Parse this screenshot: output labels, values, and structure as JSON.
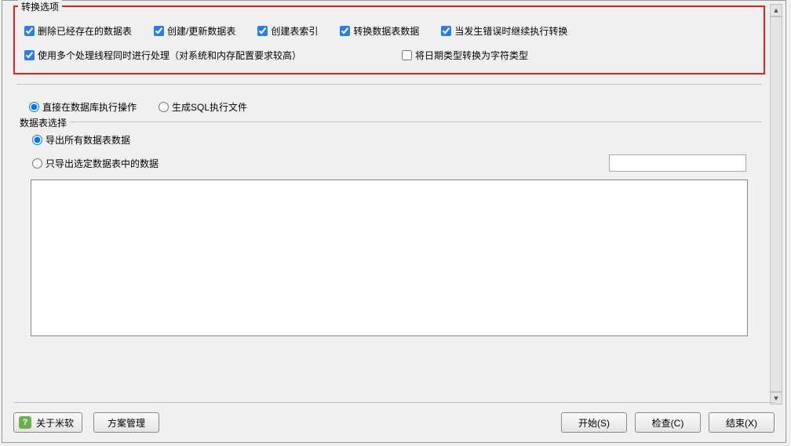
{
  "conversionOptions": {
    "legend": "转换选项",
    "row1": {
      "deleteExisting": {
        "label": "删除已经存在的数据表",
        "checked": true
      },
      "createUpdate": {
        "label": "创建/更新数据表",
        "checked": true
      },
      "createIndex": {
        "label": "创建表索引",
        "checked": true
      },
      "convertData": {
        "label": "转换数据表数据",
        "checked": true
      },
      "continueOnError": {
        "label": "当发生错误时继续执行转换",
        "checked": true
      }
    },
    "row2": {
      "multiThread": {
        "label": "使用多个处理线程同时进行处理（对系统和内存配置要求较高）",
        "checked": true
      },
      "dateToString": {
        "label": "将日期类型转换为字符类型",
        "checked": false
      }
    }
  },
  "executionMode": {
    "direct": {
      "label": "直接在数据库执行操作",
      "selected": true
    },
    "generateSql": {
      "label": "生成SQL执行文件",
      "selected": false
    }
  },
  "tableSelection": {
    "legend": "数据表选择",
    "exportAll": {
      "label": "导出所有数据表数据",
      "selected": true
    },
    "exportSelected": {
      "label": "只导出选定数据表中的数据",
      "selected": false
    },
    "filterValue": ""
  },
  "buttons": {
    "about": "关于米软",
    "schemeManage": "方案管理",
    "start": "开始(S)",
    "check": "检查(C)",
    "end": "结束(X)"
  }
}
